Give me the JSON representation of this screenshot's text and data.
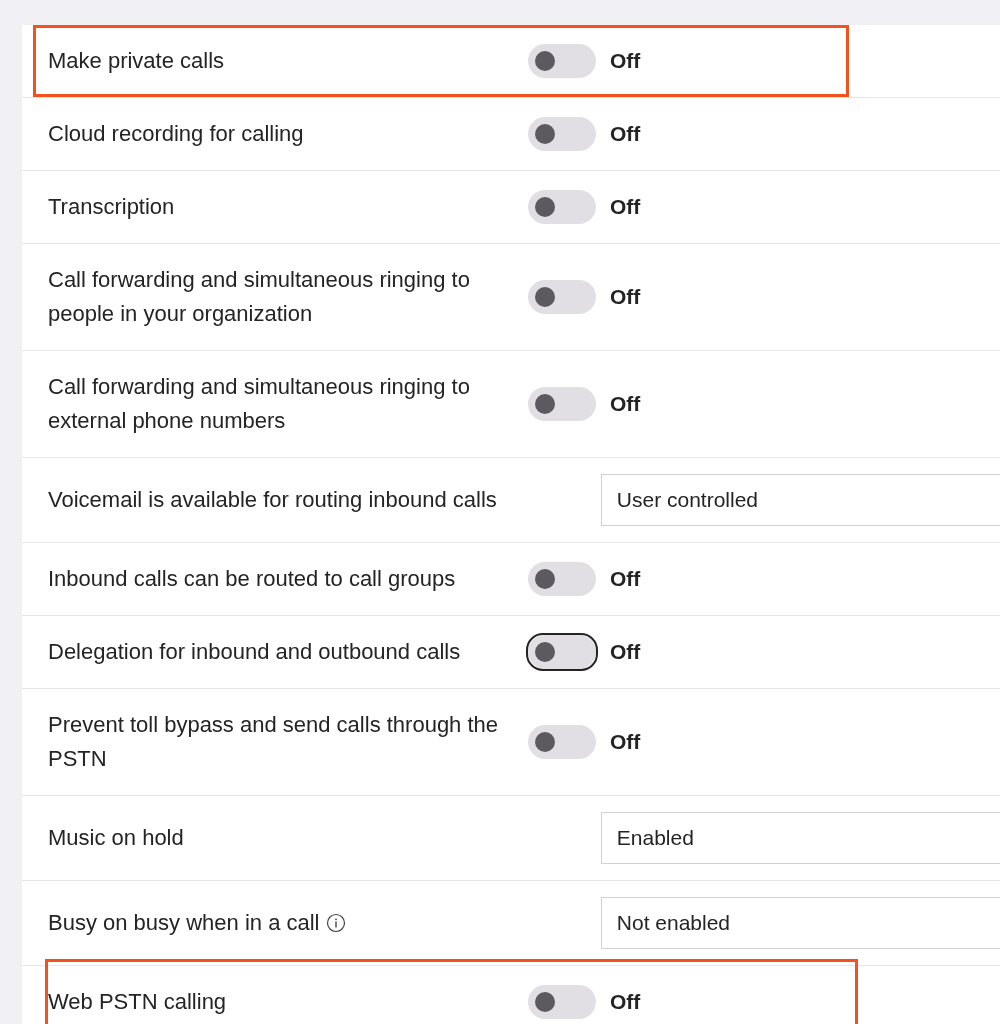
{
  "settings": [
    {
      "label": "Make private calls",
      "kind": "toggle",
      "on": false,
      "state_text": "Off",
      "focused": false,
      "highlighted": true
    },
    {
      "label": "Cloud recording for calling",
      "kind": "toggle",
      "on": false,
      "state_text": "Off",
      "focused": false,
      "highlighted": false
    },
    {
      "label": "Transcription",
      "kind": "toggle",
      "on": false,
      "state_text": "Off",
      "focused": false,
      "highlighted": false
    },
    {
      "label": "Call forwarding and simultaneous ringing to people in your organization",
      "kind": "toggle",
      "on": false,
      "state_text": "Off",
      "focused": false,
      "highlighted": false
    },
    {
      "label": "Call forwarding and simultaneous ringing to external phone numbers",
      "kind": "toggle",
      "on": false,
      "state_text": "Off",
      "focused": false,
      "highlighted": false
    },
    {
      "label": "Voicemail is available for routing inbound calls",
      "kind": "dropdown",
      "value": "User controlled",
      "info": false,
      "highlighted": false
    },
    {
      "label": "Inbound calls can be routed to call groups",
      "kind": "toggle",
      "on": false,
      "state_text": "Off",
      "focused": false,
      "highlighted": false
    },
    {
      "label": "Delegation for inbound and outbound calls",
      "kind": "toggle",
      "on": false,
      "state_text": "Off",
      "focused": true,
      "highlighted": false
    },
    {
      "label": "Prevent toll bypass and send calls through the PSTN",
      "kind": "toggle",
      "on": false,
      "state_text": "Off",
      "focused": false,
      "highlighted": false
    },
    {
      "label": "Music on hold",
      "kind": "dropdown",
      "value": "Enabled",
      "info": false,
      "highlighted": false
    },
    {
      "label": "Busy on busy when in a call",
      "kind": "dropdown",
      "value": "Not enabled",
      "info": true,
      "highlighted": false
    },
    {
      "label": "Web PSTN calling",
      "kind": "toggle",
      "on": false,
      "state_text": "Off",
      "focused": false,
      "highlighted": true
    }
  ]
}
